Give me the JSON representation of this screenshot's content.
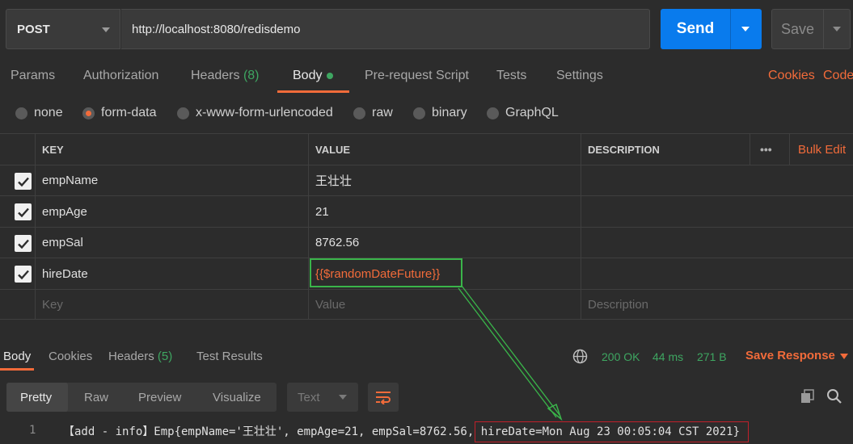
{
  "request": {
    "method": "POST",
    "url": "http://localhost:8080/redisdemo",
    "send_label": "Send",
    "save_label": "Save"
  },
  "tabs": [
    {
      "label": "Params"
    },
    {
      "label": "Authorization"
    },
    {
      "label": "Headers",
      "count": "(8)"
    },
    {
      "label": "Body",
      "active": true
    },
    {
      "label": "Pre-request Script"
    },
    {
      "label": "Tests"
    },
    {
      "label": "Settings"
    }
  ],
  "tab_links": {
    "cookies": "Cookies",
    "code": "Code"
  },
  "body_modes": [
    {
      "label": "none"
    },
    {
      "label": "form-data",
      "selected": true
    },
    {
      "label": "x-www-form-urlencoded"
    },
    {
      "label": "raw"
    },
    {
      "label": "binary"
    },
    {
      "label": "GraphQL"
    }
  ],
  "table": {
    "headers": {
      "key": "KEY",
      "value": "VALUE",
      "description": "DESCRIPTION",
      "more": "•••",
      "bulk_edit": "Bulk Edit"
    },
    "rows": [
      {
        "key": "empName",
        "value": "王壮壮",
        "checked": true
      },
      {
        "key": "empAge",
        "value": "21",
        "checked": true
      },
      {
        "key": "empSal",
        "value": "8762.56",
        "checked": true
      },
      {
        "key": "hireDate",
        "value": "{{$randomDateFuture}}",
        "checked": true
      }
    ],
    "placeholders": {
      "key": "Key",
      "value": "Value",
      "description": "Description"
    }
  },
  "response": {
    "tabs": [
      {
        "label": "Body",
        "active": true
      },
      {
        "label": "Cookies"
      },
      {
        "label": "Headers",
        "count": "(5)"
      },
      {
        "label": "Test Results"
      }
    ],
    "status": "200 OK",
    "time": "44 ms",
    "size": "271 B",
    "save_response": "Save Response",
    "views": [
      "Pretty",
      "Raw",
      "Preview",
      "Visualize"
    ],
    "format": "Text",
    "line_number": "1",
    "line_text": "【add - info】Emp{empName='王壮壮', empAge=21, empSal=8762.56, ",
    "line_highlight": "hireDate=Mon Aug 23 00:05:04 CST 2021}"
  },
  "colors": {
    "accent": "#f26b3a",
    "send": "#097bed",
    "success": "#3ea661",
    "annotation_green": "#3ab54a",
    "annotation_red": "#c0202a"
  }
}
